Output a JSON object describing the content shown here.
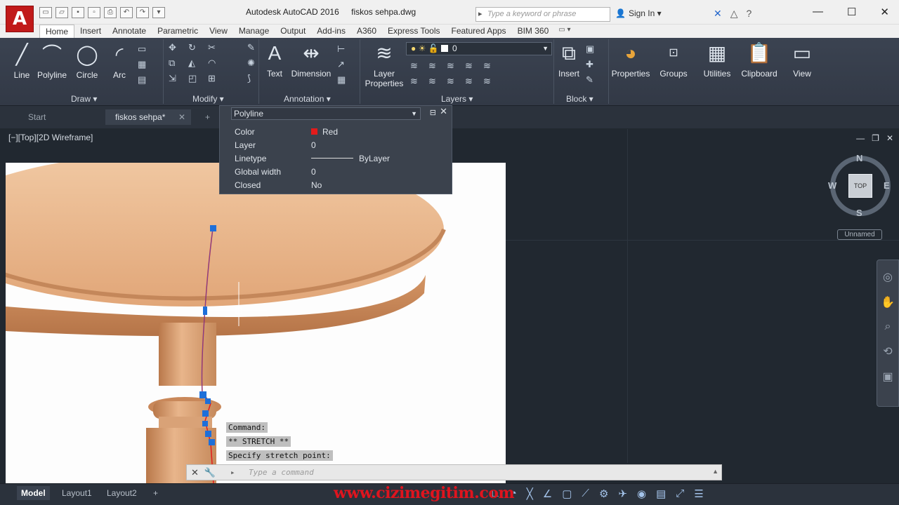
{
  "app": {
    "logo": "A",
    "title": "Autodesk AutoCAD 2016",
    "document": "fiskos sehpa.dwg"
  },
  "search": {
    "placeholder": "Type a keyword or phrase"
  },
  "account": {
    "signin": "Sign In"
  },
  "ribbon_tabs": [
    "Home",
    "Insert",
    "Annotate",
    "Parametric",
    "View",
    "Manage",
    "Output",
    "Add-ins",
    "A360",
    "Express Tools",
    "Featured Apps",
    "BIM 360"
  ],
  "ribbon": {
    "draw": {
      "line": "Line",
      "polyline": "Polyline",
      "circle": "Circle",
      "arc": "Arc",
      "panel": "Draw"
    },
    "modify": {
      "panel": "Modify"
    },
    "annotation": {
      "text": "Text",
      "dimension": "Dimension",
      "panel": "Annotation"
    },
    "layers": {
      "layer_properties_1": "Layer",
      "layer_properties_2": "Properties",
      "current_layer": "0",
      "panel": "Layers"
    },
    "block": {
      "insert": "Insert",
      "panel": "Block"
    },
    "properties": "Properties",
    "groups": "Groups",
    "utilities": "Utilities",
    "clipboard": "Clipboard",
    "view": "View"
  },
  "doc_tabs": {
    "start": "Start",
    "active": "fiskos sehpa*"
  },
  "viewport": {
    "label": "[−][Top][2D Wireframe]"
  },
  "quick_properties": {
    "object_type": "Polyline",
    "rows": [
      {
        "key": "Color",
        "value": "Red"
      },
      {
        "key": "Layer",
        "value": "0"
      },
      {
        "key": "Linetype",
        "value": "ByLayer"
      },
      {
        "key": "Global width",
        "value": "0"
      },
      {
        "key": "Closed",
        "value": "No"
      }
    ]
  },
  "viewcube": {
    "north": "N",
    "south": "S",
    "east": "E",
    "west": "W",
    "face": "TOP",
    "ucs": "Unnamed"
  },
  "command_history": [
    "Command:",
    "** STRETCH **",
    "Specify stretch point:"
  ],
  "command_line": {
    "placeholder": "Type a command"
  },
  "layouts": [
    "Model",
    "Layout1",
    "Layout2"
  ],
  "watermark": "www.cizimegitim.com",
  "colors": {
    "ribbon_bg": "#3b4351",
    "canvas_bg": "#212830",
    "polyline": "#e31b1b",
    "grip": "#1e6fd9"
  }
}
